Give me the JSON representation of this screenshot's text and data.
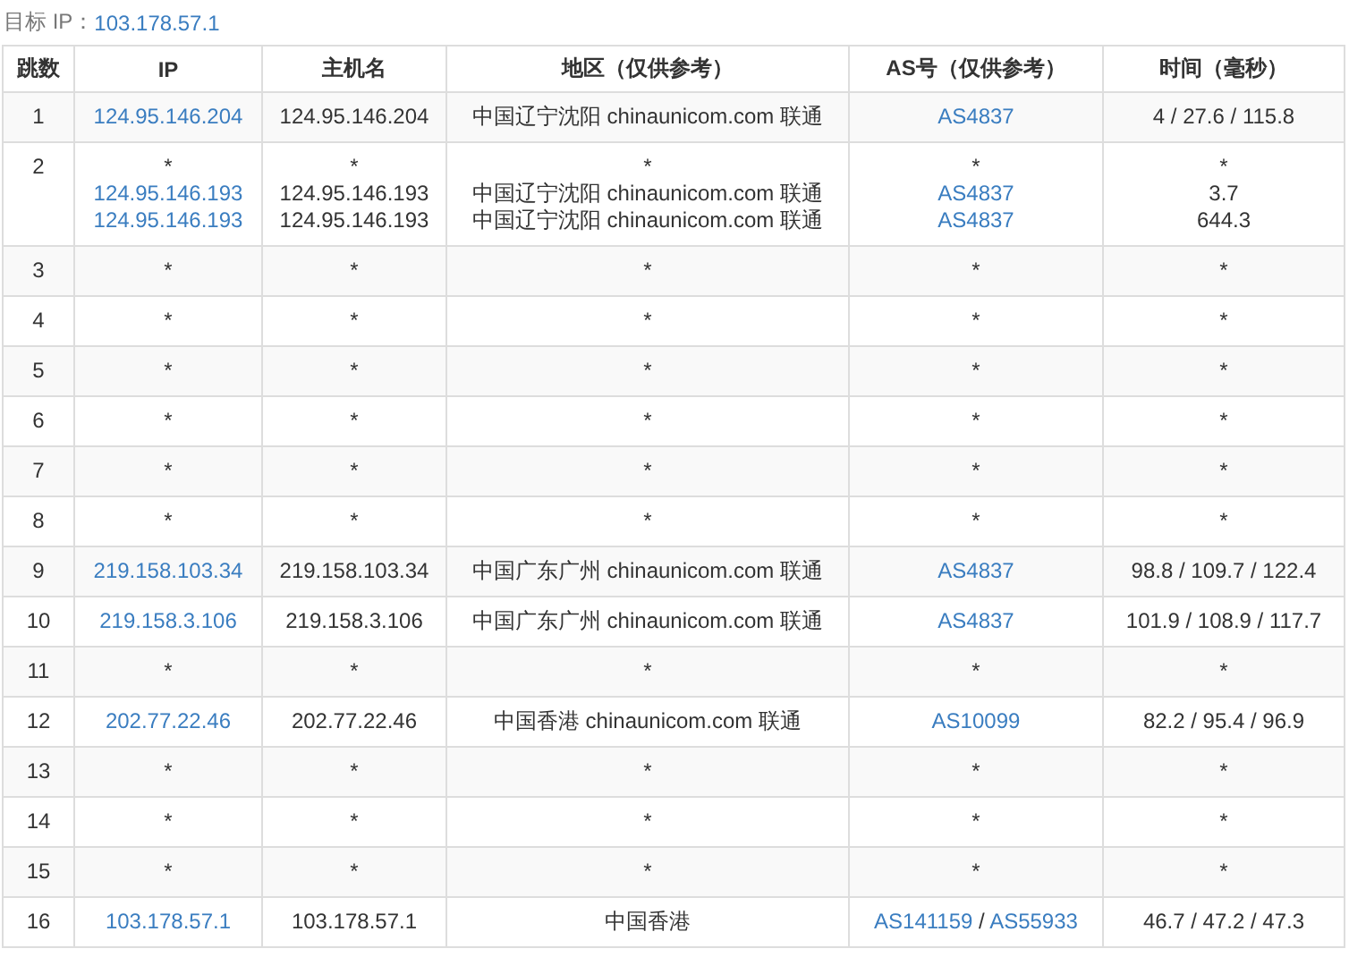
{
  "target": {
    "label": "目标 IP：",
    "value": "103.178.57.1"
  },
  "columns": [
    "跳数",
    "IP",
    "主机名",
    "地区（仅供参考）",
    "AS号（仅供参考）",
    "时间（毫秒）"
  ],
  "rows": [
    {
      "hop": "1",
      "ip": [
        [
          {
            "t": "124.95.146.204",
            "link": true
          }
        ]
      ],
      "host": [
        [
          {
            "t": "124.95.146.204",
            "link": false
          }
        ]
      ],
      "region": [
        [
          {
            "t": "中国辽宁沈阳 chinaunicom.com 联通",
            "link": false
          }
        ]
      ],
      "as": [
        [
          {
            "t": "AS4837",
            "link": true
          }
        ]
      ],
      "time": [
        [
          {
            "t": "4 / 27.6 / 115.8",
            "link": false
          }
        ]
      ]
    },
    {
      "hop": "2",
      "ip": [
        [
          {
            "t": "*",
            "link": false
          }
        ],
        [
          {
            "t": "124.95.146.193",
            "link": true
          }
        ],
        [
          {
            "t": "124.95.146.193",
            "link": true
          }
        ]
      ],
      "host": [
        [
          {
            "t": "*",
            "link": false
          }
        ],
        [
          {
            "t": "124.95.146.193",
            "link": false
          }
        ],
        [
          {
            "t": "124.95.146.193",
            "link": false
          }
        ]
      ],
      "region": [
        [
          {
            "t": "*",
            "link": false
          }
        ],
        [
          {
            "t": "中国辽宁沈阳 chinaunicom.com 联通",
            "link": false
          }
        ],
        [
          {
            "t": "中国辽宁沈阳 chinaunicom.com 联通",
            "link": false
          }
        ]
      ],
      "as": [
        [
          {
            "t": "*",
            "link": false
          }
        ],
        [
          {
            "t": "AS4837",
            "link": true
          }
        ],
        [
          {
            "t": "AS4837",
            "link": true
          }
        ]
      ],
      "time": [
        [
          {
            "t": "*",
            "link": false
          }
        ],
        [
          {
            "t": "3.7",
            "link": false
          }
        ],
        [
          {
            "t": "644.3",
            "link": false
          }
        ]
      ]
    },
    {
      "hop": "3",
      "ip": [
        [
          {
            "t": "*",
            "link": false
          }
        ]
      ],
      "host": [
        [
          {
            "t": "*",
            "link": false
          }
        ]
      ],
      "region": [
        [
          {
            "t": "*",
            "link": false
          }
        ]
      ],
      "as": [
        [
          {
            "t": "*",
            "link": false
          }
        ]
      ],
      "time": [
        [
          {
            "t": "*",
            "link": false
          }
        ]
      ]
    },
    {
      "hop": "4",
      "ip": [
        [
          {
            "t": "*",
            "link": false
          }
        ]
      ],
      "host": [
        [
          {
            "t": "*",
            "link": false
          }
        ]
      ],
      "region": [
        [
          {
            "t": "*",
            "link": false
          }
        ]
      ],
      "as": [
        [
          {
            "t": "*",
            "link": false
          }
        ]
      ],
      "time": [
        [
          {
            "t": "*",
            "link": false
          }
        ]
      ]
    },
    {
      "hop": "5",
      "ip": [
        [
          {
            "t": "*",
            "link": false
          }
        ]
      ],
      "host": [
        [
          {
            "t": "*",
            "link": false
          }
        ]
      ],
      "region": [
        [
          {
            "t": "*",
            "link": false
          }
        ]
      ],
      "as": [
        [
          {
            "t": "*",
            "link": false
          }
        ]
      ],
      "time": [
        [
          {
            "t": "*",
            "link": false
          }
        ]
      ]
    },
    {
      "hop": "6",
      "ip": [
        [
          {
            "t": "*",
            "link": false
          }
        ]
      ],
      "host": [
        [
          {
            "t": "*",
            "link": false
          }
        ]
      ],
      "region": [
        [
          {
            "t": "*",
            "link": false
          }
        ]
      ],
      "as": [
        [
          {
            "t": "*",
            "link": false
          }
        ]
      ],
      "time": [
        [
          {
            "t": "*",
            "link": false
          }
        ]
      ]
    },
    {
      "hop": "7",
      "ip": [
        [
          {
            "t": "*",
            "link": false
          }
        ]
      ],
      "host": [
        [
          {
            "t": "*",
            "link": false
          }
        ]
      ],
      "region": [
        [
          {
            "t": "*",
            "link": false
          }
        ]
      ],
      "as": [
        [
          {
            "t": "*",
            "link": false
          }
        ]
      ],
      "time": [
        [
          {
            "t": "*",
            "link": false
          }
        ]
      ]
    },
    {
      "hop": "8",
      "ip": [
        [
          {
            "t": "*",
            "link": false
          }
        ]
      ],
      "host": [
        [
          {
            "t": "*",
            "link": false
          }
        ]
      ],
      "region": [
        [
          {
            "t": "*",
            "link": false
          }
        ]
      ],
      "as": [
        [
          {
            "t": "*",
            "link": false
          }
        ]
      ],
      "time": [
        [
          {
            "t": "*",
            "link": false
          }
        ]
      ]
    },
    {
      "hop": "9",
      "ip": [
        [
          {
            "t": "219.158.103.34",
            "link": true
          }
        ]
      ],
      "host": [
        [
          {
            "t": "219.158.103.34",
            "link": false
          }
        ]
      ],
      "region": [
        [
          {
            "t": "中国广东广州 chinaunicom.com 联通",
            "link": false
          }
        ]
      ],
      "as": [
        [
          {
            "t": "AS4837",
            "link": true
          }
        ]
      ],
      "time": [
        [
          {
            "t": "98.8 / 109.7 / 122.4",
            "link": false
          }
        ]
      ]
    },
    {
      "hop": "10",
      "ip": [
        [
          {
            "t": "219.158.3.106",
            "link": true
          }
        ]
      ],
      "host": [
        [
          {
            "t": "219.158.3.106",
            "link": false
          }
        ]
      ],
      "region": [
        [
          {
            "t": "中国广东广州 chinaunicom.com 联通",
            "link": false
          }
        ]
      ],
      "as": [
        [
          {
            "t": "AS4837",
            "link": true
          }
        ]
      ],
      "time": [
        [
          {
            "t": "101.9 / 108.9 / 117.7",
            "link": false
          }
        ]
      ]
    },
    {
      "hop": "11",
      "ip": [
        [
          {
            "t": "*",
            "link": false
          }
        ]
      ],
      "host": [
        [
          {
            "t": "*",
            "link": false
          }
        ]
      ],
      "region": [
        [
          {
            "t": "*",
            "link": false
          }
        ]
      ],
      "as": [
        [
          {
            "t": "*",
            "link": false
          }
        ]
      ],
      "time": [
        [
          {
            "t": "*",
            "link": false
          }
        ]
      ]
    },
    {
      "hop": "12",
      "ip": [
        [
          {
            "t": "202.77.22.46",
            "link": true
          }
        ]
      ],
      "host": [
        [
          {
            "t": "202.77.22.46",
            "link": false
          }
        ]
      ],
      "region": [
        [
          {
            "t": "中国香港 chinaunicom.com 联通",
            "link": false
          }
        ]
      ],
      "as": [
        [
          {
            "t": "AS10099",
            "link": true
          }
        ]
      ],
      "time": [
        [
          {
            "t": "82.2 / 95.4 / 96.9",
            "link": false
          }
        ]
      ]
    },
    {
      "hop": "13",
      "ip": [
        [
          {
            "t": "*",
            "link": false
          }
        ]
      ],
      "host": [
        [
          {
            "t": "*",
            "link": false
          }
        ]
      ],
      "region": [
        [
          {
            "t": "*",
            "link": false
          }
        ]
      ],
      "as": [
        [
          {
            "t": "*",
            "link": false
          }
        ]
      ],
      "time": [
        [
          {
            "t": "*",
            "link": false
          }
        ]
      ]
    },
    {
      "hop": "14",
      "ip": [
        [
          {
            "t": "*",
            "link": false
          }
        ]
      ],
      "host": [
        [
          {
            "t": "*",
            "link": false
          }
        ]
      ],
      "region": [
        [
          {
            "t": "*",
            "link": false
          }
        ]
      ],
      "as": [
        [
          {
            "t": "*",
            "link": false
          }
        ]
      ],
      "time": [
        [
          {
            "t": "*",
            "link": false
          }
        ]
      ]
    },
    {
      "hop": "15",
      "ip": [
        [
          {
            "t": "*",
            "link": false
          }
        ]
      ],
      "host": [
        [
          {
            "t": "*",
            "link": false
          }
        ]
      ],
      "region": [
        [
          {
            "t": "*",
            "link": false
          }
        ]
      ],
      "as": [
        [
          {
            "t": "*",
            "link": false
          }
        ]
      ],
      "time": [
        [
          {
            "t": "*",
            "link": false
          }
        ]
      ]
    },
    {
      "hop": "16",
      "ip": [
        [
          {
            "t": "103.178.57.1",
            "link": true
          }
        ]
      ],
      "host": [
        [
          {
            "t": "103.178.57.1",
            "link": false
          }
        ]
      ],
      "region": [
        [
          {
            "t": "中国香港",
            "link": false
          }
        ]
      ],
      "as": [
        [
          {
            "t": "AS141159",
            "link": true
          },
          {
            "t": " / ",
            "link": false
          },
          {
            "t": "AS55933",
            "link": true
          }
        ]
      ],
      "time": [
        [
          {
            "t": "46.7 / 47.2 / 47.3",
            "link": false
          }
        ]
      ]
    }
  ]
}
